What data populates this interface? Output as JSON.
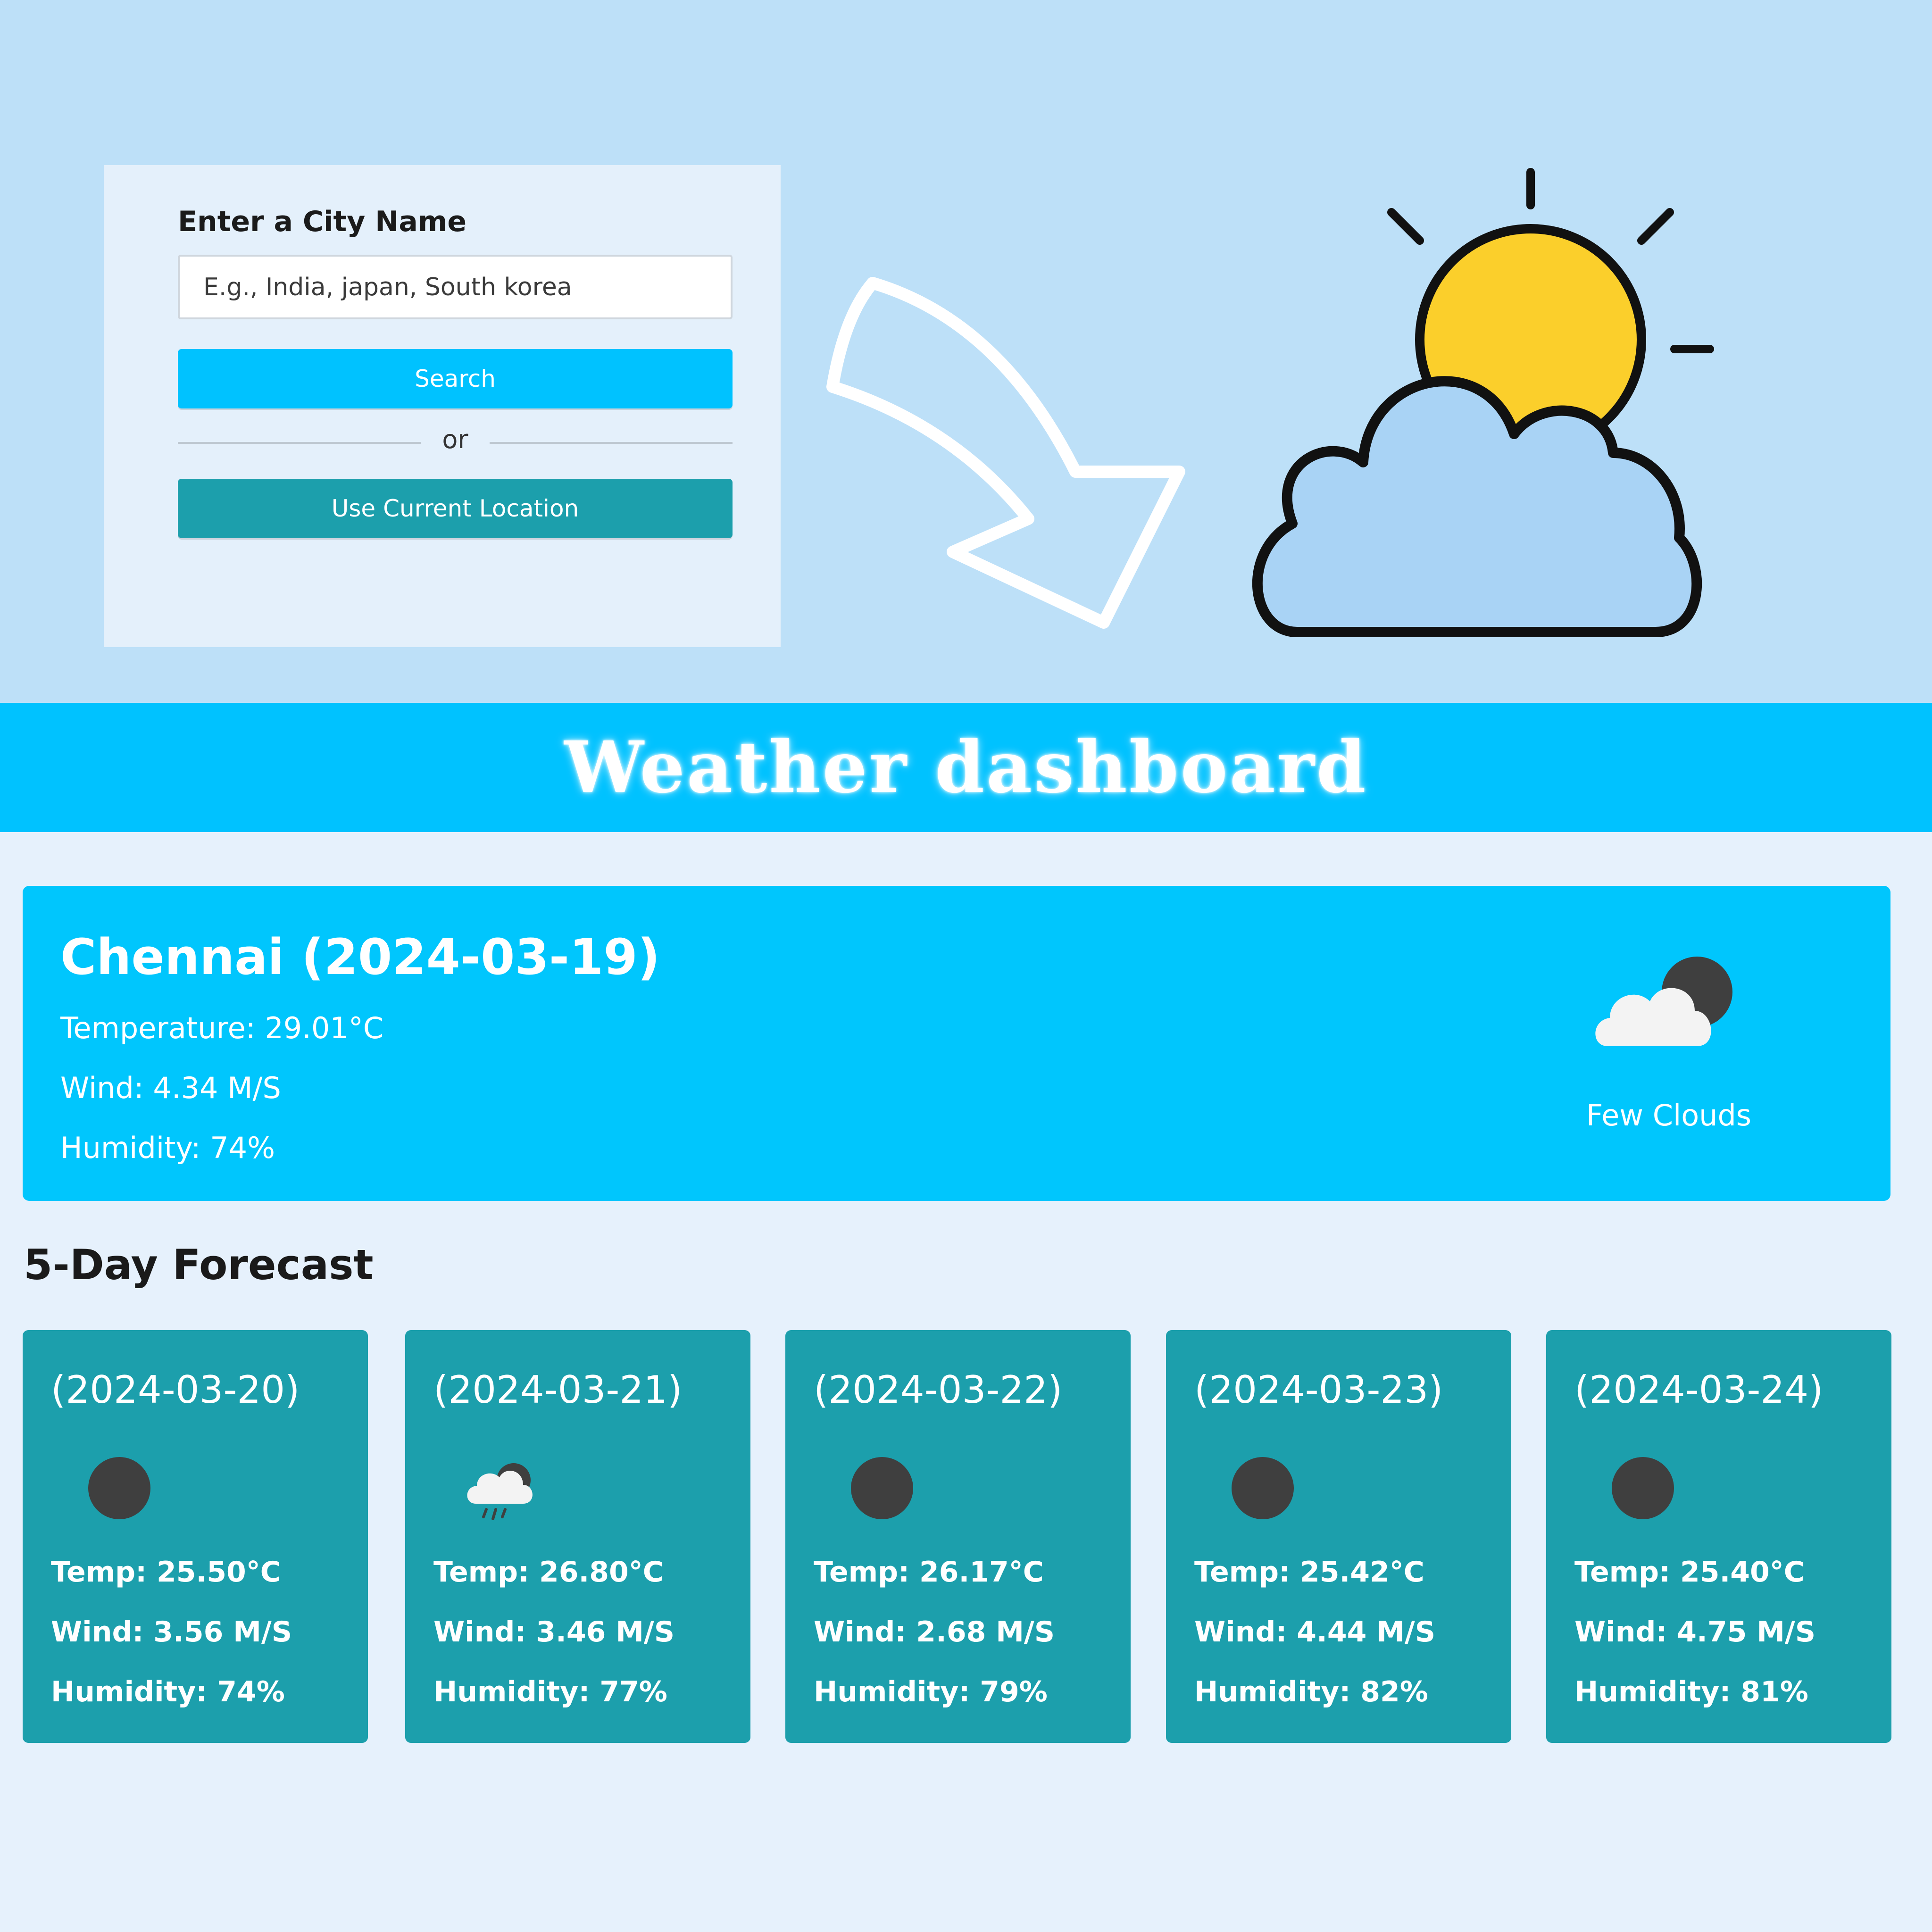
{
  "search": {
    "label": "Enter a City Name",
    "placeholder": "E.g., India, japan, South korea",
    "value": "",
    "search_button": "Search",
    "divider_text": "or",
    "location_button": "Use Current Location"
  },
  "illustrations": {
    "arrow": "curved-arrow-icon",
    "weather": "partly-cloudy-sun-icon"
  },
  "header": {
    "title": "Weather dashboard"
  },
  "current": {
    "title": "Chennai (2024-03-19)",
    "temperature": "Temperature: 29.01°C",
    "wind": "Wind: 4.34 M/S",
    "humidity": "Humidity: 74%",
    "icon": "few-clouds-night-icon",
    "description": "Few Clouds"
  },
  "forecast": {
    "heading": "5-Day Forecast",
    "days": [
      {
        "date": "(2024-03-20)",
        "icon": "clear-night-icon",
        "temp": "Temp: 25.50°C",
        "wind": "Wind: 3.56 M/S",
        "humidity": "Humidity: 74%"
      },
      {
        "date": "(2024-03-21)",
        "icon": "rain-night-icon",
        "temp": "Temp: 26.80°C",
        "wind": "Wind: 3.46 M/S",
        "humidity": "Humidity: 77%"
      },
      {
        "date": "(2024-03-22)",
        "icon": "clear-night-icon",
        "temp": "Temp: 26.17°C",
        "wind": "Wind: 2.68 M/S",
        "humidity": "Humidity: 79%"
      },
      {
        "date": "(2024-03-23)",
        "icon": "clear-night-icon",
        "temp": "Temp: 25.42°C",
        "wind": "Wind: 4.44 M/S",
        "humidity": "Humidity: 82%"
      },
      {
        "date": "(2024-03-24)",
        "icon": "clear-night-icon",
        "temp": "Temp: 25.40°C",
        "wind": "Wind: 4.75 M/S",
        "humidity": "Humidity: 81%"
      }
    ]
  },
  "colors": {
    "accent": "#00c2ff",
    "secondary": "#1c9fac",
    "background": "#e6f1fc",
    "top_background": "#bde0f8"
  }
}
